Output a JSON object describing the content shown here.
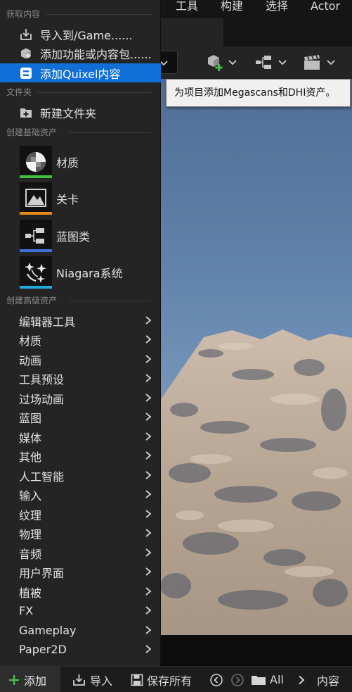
{
  "editor": {
    "top_menu": [
      "工具",
      "构建",
      "选择",
      "Actor"
    ]
  },
  "tooltip": "为项目添加Megascans和DHI资产。",
  "menu": {
    "sections": {
      "get_content": "获取内容",
      "folder": "文件夹",
      "basic_assets": "创建基础资产",
      "advanced_assets": "创建高级资产"
    },
    "get_content_items": [
      {
        "label": "导入到/Game......",
        "icon": "import-icon"
      },
      {
        "label": "添加功能或内容包......",
        "icon": "feature-pack-icon"
      },
      {
        "label": "添加Quixel内容",
        "icon": "quixel-icon",
        "selected": true
      }
    ],
    "new_folder": {
      "label": "新建文件夹",
      "icon": "new-folder-icon"
    },
    "basic_assets": [
      {
        "label": "材质",
        "icon": "material-icon",
        "color": "#3fbf3f"
      },
      {
        "label": "关卡",
        "icon": "level-icon",
        "color": "#e88a16"
      },
      {
        "label": "蓝图类",
        "icon": "blueprint-icon",
        "color": "#3e70d8"
      },
      {
        "label": "Niagara系统",
        "icon": "niagara-icon",
        "color": "#25a8e0"
      }
    ],
    "advanced_assets": [
      "编辑器工具",
      "材质",
      "动画",
      "工具预设",
      "过场动画",
      "蓝图",
      "媒体",
      "其他",
      "人工智能",
      "输入",
      "纹理",
      "物理",
      "音频",
      "用户界面",
      "植被",
      "FX",
      "Gameplay",
      "Paper2D"
    ]
  },
  "bottom_bar": {
    "add": "添加",
    "import": "导入",
    "save_all": "保存所有",
    "path_all": "All",
    "path_content": "内容"
  },
  "colors": {
    "selection": "#0f6fd6",
    "menu_bg": "#242424"
  }
}
